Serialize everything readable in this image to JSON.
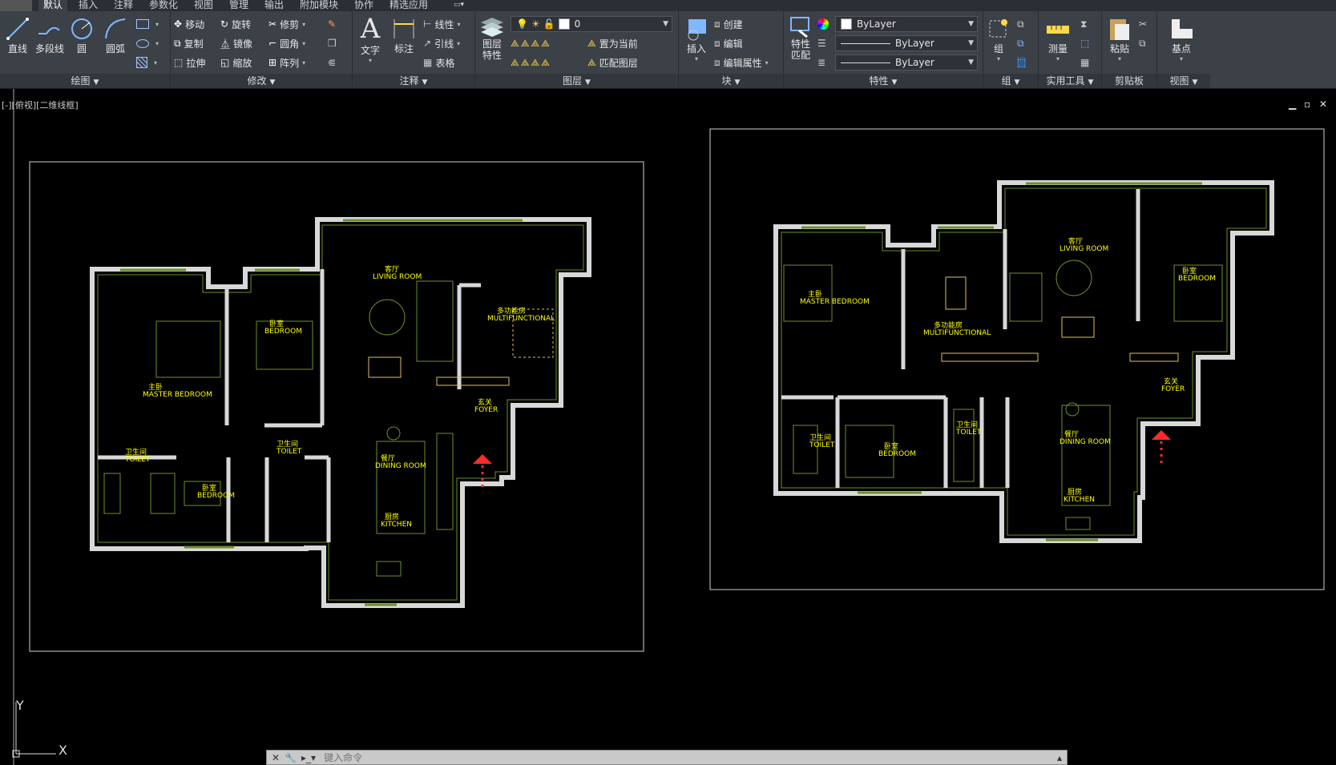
{
  "menu_tabs": [
    "默认",
    "插入",
    "注释",
    "参数化",
    "视图",
    "管理",
    "输出",
    "附加模块",
    "协作",
    "精选应用"
  ],
  "panels": {
    "draw": {
      "title": "绘图",
      "line": "直线",
      "polyline": "多段线",
      "circle": "圆",
      "arc": "圆弧"
    },
    "modify": {
      "title": "修改",
      "move": "移动",
      "rotate": "旋转",
      "trim": "修剪",
      "copy": "复制",
      "mirror": "镜像",
      "fillet": "圆角",
      "stretch": "拉伸",
      "scale": "缩放",
      "array": "阵列"
    },
    "annotation": {
      "title": "注释",
      "text": "文字",
      "dimension": "标注",
      "linear": "线性",
      "leader": "引线",
      "table": "表格"
    },
    "layers": {
      "title": "图层",
      "layer_props_1": "图层",
      "layer_props_2": "特性",
      "layer_value": "0",
      "set_current": "置为当前",
      "match_layer": "匹配图层"
    },
    "block": {
      "title": "块",
      "insert": "插入",
      "create": "创建",
      "edit": "编辑",
      "edit_attr": "编辑属性"
    },
    "properties": {
      "title": "特性",
      "match_1": "特性",
      "match_2": "匹配",
      "color": "ByLayer",
      "linetype": "ByLayer",
      "lineweight": "ByLayer"
    },
    "groups": {
      "title": "组",
      "group": "组"
    },
    "utilities": {
      "title": "实用工具",
      "measure": "测量"
    },
    "clipboard": {
      "title": "剪贴板",
      "paste": "粘贴"
    },
    "view": {
      "title": "视图",
      "base": "基点"
    }
  },
  "viewport_label": "[-][俯视][二维线框]",
  "window_controls": {
    "minimize": "▁",
    "restore": "▫",
    "close": "✕"
  },
  "ucs": {
    "y": "Y",
    "x": "X"
  },
  "command_line": {
    "placeholder": "键入命令"
  },
  "plan_left": {
    "living": "客厅",
    "living_en": "LIVING ROOM",
    "multi": "多功能房",
    "multi_en": "MULTIFUNCTIONAL",
    "bedroom": "卧室",
    "bedroom_en": "BEDROOM",
    "master": "主卧",
    "master_en": "MASTER BEDROOM",
    "foyer": "玄关",
    "foyer_en": "FOYER",
    "toilet": "卫生间",
    "toilet_en": "TOILET",
    "toilet2": "卫生间",
    "toilet2_en": "TOILET",
    "bedroom2": "卧室",
    "bedroom2_en": "BEDROOM",
    "dining": "餐厅",
    "dining_en": "DINING ROOM",
    "kitchen": "厨房",
    "kitchen_en": "KITCHEN"
  },
  "plan_right": {
    "living": "客厅",
    "living_en": "LIVING ROOM",
    "multi": "多功能房",
    "multi_en": "MULTIFUNCTIONAL",
    "bedroom": "卧室",
    "bedroom_en": "BEDROOM",
    "master": "主卧",
    "master_en": "MASTER BEDROOM",
    "foyer": "玄关",
    "foyer_en": "FOYER",
    "toilet": "卫生间",
    "toilet_en": "TOILET",
    "toilet2": "卫生间",
    "toilet2_en": "TOILET",
    "bedroom2": "卧室",
    "bedroom2_en": "BEDROOM",
    "dining": "餐厅",
    "dining_en": "DINING ROOM",
    "kitchen": "厨房",
    "kitchen_en": "KITCHEN"
  },
  "colors": {
    "wall": "#e0e0e0",
    "line": "#6b8f2a",
    "label": "#ffff00",
    "arrow": "#ff2a2a"
  }
}
